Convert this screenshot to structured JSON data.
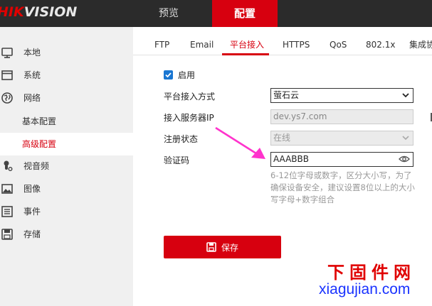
{
  "brand": {
    "logo_red": "HIK",
    "logo_white": "VISION"
  },
  "topnav": {
    "preview": "预览",
    "config": "配置"
  },
  "sidebar": {
    "items": [
      {
        "label": "本地",
        "icon": "monitor-icon"
      },
      {
        "label": "系统",
        "icon": "window-icon"
      },
      {
        "label": "网络",
        "icon": "globe-icon"
      },
      {
        "label": "基本配置"
      },
      {
        "label": "高级配置"
      },
      {
        "label": "视音频",
        "icon": "mic-icon"
      },
      {
        "label": "图像",
        "icon": "image-icon"
      },
      {
        "label": "事件",
        "icon": "list-icon"
      },
      {
        "label": "存储",
        "icon": "disk-icon"
      }
    ]
  },
  "tabs": [
    "FTP",
    "Email",
    "平台接入",
    "HTTPS",
    "QoS",
    "802.1x",
    "集成协议"
  ],
  "form": {
    "enable_label": "启用",
    "access_mode_label": "平台接入方式",
    "access_mode_value": "萤石云",
    "server_ip_label": "接入服务器IP",
    "server_ip_value": "dev.ys7.com",
    "reg_status_label": "注册状态",
    "reg_status_value": "在线",
    "verify_code_label": "验证码",
    "verify_code_value": "AAABBB",
    "hint": "6-12位字母或数字，区分大小写，为了确保设备安全，建议设置8位以上的大小写字母+数字组合"
  },
  "save_button": "保存",
  "watermark": {
    "cn": "下固件网",
    "url": "xiagujian.com"
  },
  "colors": {
    "accent": "#d7000f",
    "topbar": "#2b2b2b",
    "sidebar": "#f0f0f0",
    "arrow": "#ff33cc"
  }
}
